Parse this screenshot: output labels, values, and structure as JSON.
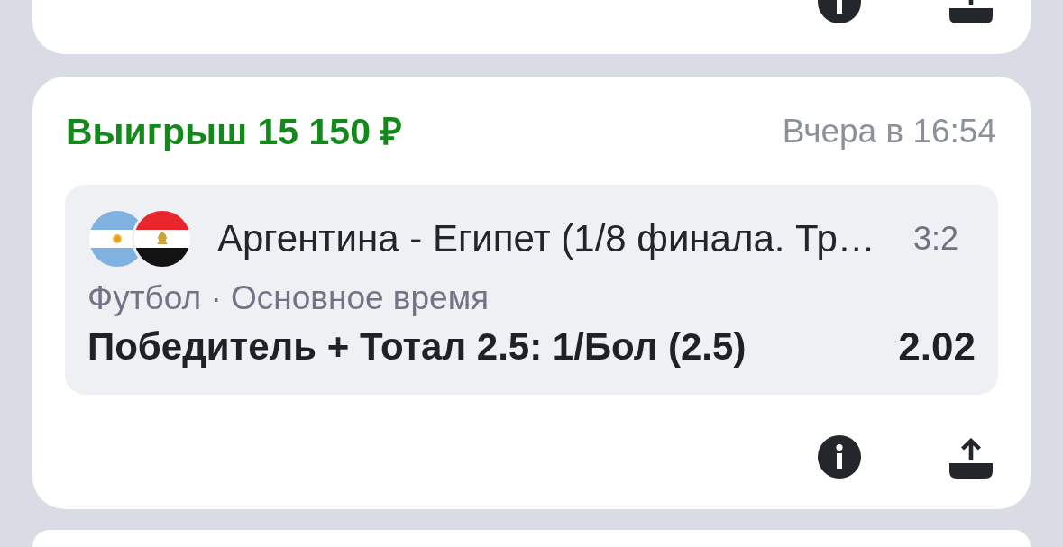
{
  "bets": [
    {
      "kind": "won",
      "result": "Выигрыш 15 150 ₽",
      "time": "Вчера в 16:54",
      "events": [
        {
          "match": "Аргентина - Египет (1/8 финала. Тр…",
          "score": "3:2",
          "sport_line": "Футбол · Основное время",
          "selection": "Победитель + Тотал 2.5: 1/Бол (2.5)",
          "odds": "2.02"
        }
      ]
    }
  ]
}
